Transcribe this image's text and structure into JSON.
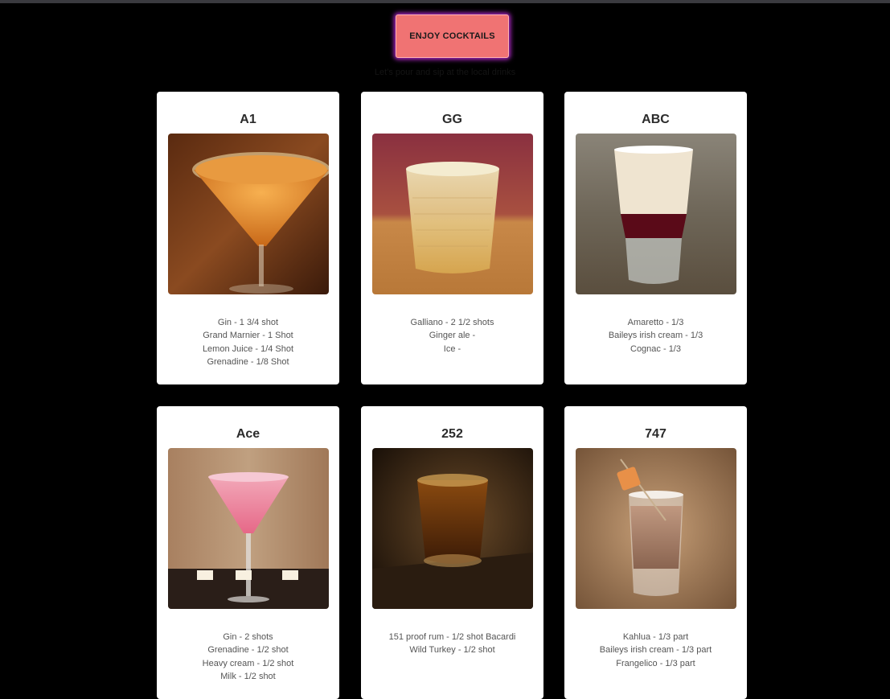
{
  "header": {
    "button_label": "ENJOY COCKTAILS",
    "subtitle": "Let's pour and sip at the local drinks"
  },
  "cocktails": [
    {
      "name": "A1",
      "ingredients": [
        "Gin - 1 3/4 shot",
        "Grand Marnier - 1 Shot",
        "Lemon Juice - 1/4 Shot",
        "Grenadine - 1/8 Shot"
      ]
    },
    {
      "name": "GG",
      "ingredients": [
        "Galliano - 2 1/2 shots",
        "Ginger ale -",
        "Ice -"
      ]
    },
    {
      "name": "ABC",
      "ingredients": [
        "Amaretto - 1/3",
        "Baileys irish cream - 1/3",
        "Cognac - 1/3"
      ]
    },
    {
      "name": "Ace",
      "ingredients": [
        "Gin - 2 shots",
        "Grenadine - 1/2 shot",
        "Heavy cream - 1/2 shot",
        "Milk - 1/2 shot"
      ]
    },
    {
      "name": "252",
      "ingredients": [
        "151 proof rum - 1/2 shot Bacardi",
        "Wild Turkey - 1/2 shot"
      ]
    },
    {
      "name": "747",
      "ingredients": [
        "Kahlua - 1/3 part",
        "Baileys irish cream - 1/3 part",
        "Frangelico - 1/3 part"
      ]
    }
  ]
}
